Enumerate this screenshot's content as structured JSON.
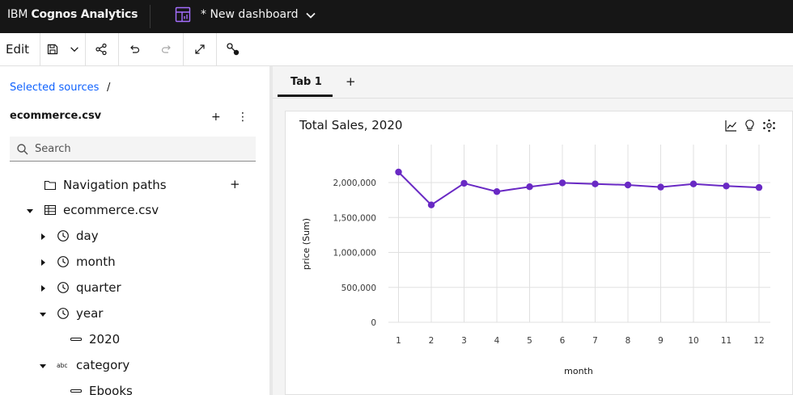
{
  "header": {
    "brand_prefix": "IBM ",
    "brand_name": "Cognos Analytics",
    "dashboard_title": "* New dashboard"
  },
  "toolbar": {
    "edit_label": "Edit"
  },
  "sources": {
    "breadcrumb_link": "Selected sources",
    "breadcrumb_sep": "/",
    "title": "ecommerce.csv",
    "add_symbol": "+",
    "more_symbol": "⋮",
    "search_placeholder": "Search"
  },
  "tree": [
    {
      "label": "Navigation paths",
      "icon": "folder-icon",
      "level": 0,
      "caret": "none",
      "add": "+"
    },
    {
      "label": "ecommerce.csv",
      "icon": "table-icon",
      "level": 0,
      "caret": "down"
    },
    {
      "label": "day",
      "icon": "clock-icon",
      "level": 1,
      "caret": "right"
    },
    {
      "label": "month",
      "icon": "clock-icon",
      "level": 1,
      "caret": "right"
    },
    {
      "label": "quarter",
      "icon": "clock-icon",
      "level": 1,
      "caret": "right"
    },
    {
      "label": "year",
      "icon": "clock-icon",
      "level": 1,
      "caret": "down"
    },
    {
      "label": "2020",
      "icon": "member-icon",
      "level": 2,
      "caret": "none"
    },
    {
      "label": "category",
      "icon": "abc-icon",
      "level": 1,
      "caret": "down",
      "icon_text": "abc"
    },
    {
      "label": "Ebooks",
      "icon": "member-icon",
      "level": 2,
      "caret": "none"
    }
  ],
  "tabs": {
    "items": [
      "Tab 1"
    ],
    "add_symbol": "+"
  },
  "chart_data": {
    "type": "line",
    "title": "Total Sales, 2020",
    "xlabel": "month",
    "ylabel": "price (Sum)",
    "categories": [
      "1",
      "2",
      "3",
      "4",
      "5",
      "6",
      "7",
      "8",
      "9",
      "10",
      "11",
      "12"
    ],
    "series": [
      {
        "values": [
          2150000,
          1680000,
          1990000,
          1870000,
          1940000,
          1995000,
          1980000,
          1965000,
          1935000,
          1980000,
          1950000,
          1930000
        ]
      }
    ],
    "ylim": [
      0,
      2000000
    ],
    "yticks": [
      "0",
      "500,000",
      "1,000,000",
      "1,500,000",
      "2,000,000"
    ],
    "grid": true,
    "colors": {
      "line": "#6929c4",
      "grid": "#e0e0e0"
    }
  }
}
